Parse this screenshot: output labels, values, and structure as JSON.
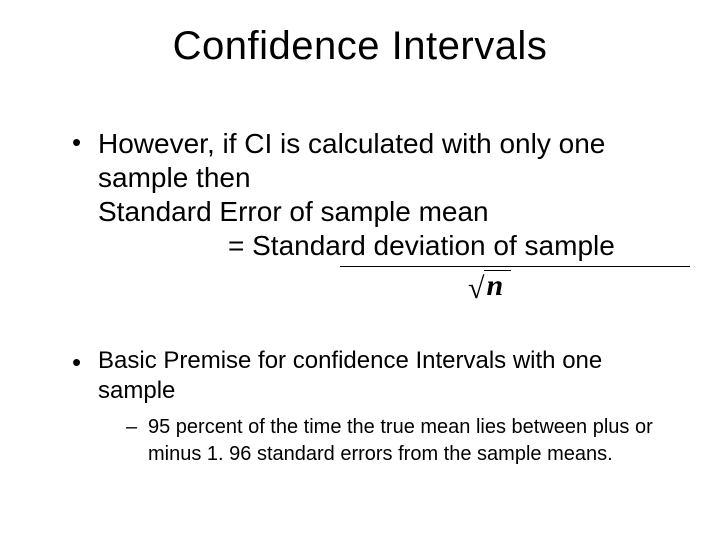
{
  "title": "Confidence Intervals",
  "bullet1": {
    "line1": "However, if CI is calculated with only one sample then",
    "line2": "Standard Error of sample mean",
    "eq_lhs": "= Standard deviation of sample",
    "denom_var": "n"
  },
  "bullet2": {
    "text": "Basic Premise for confidence Intervals with one sample",
    "sub": "95 percent of the time the true mean lies between plus or minus 1. 96 standard errors from the sample means."
  }
}
